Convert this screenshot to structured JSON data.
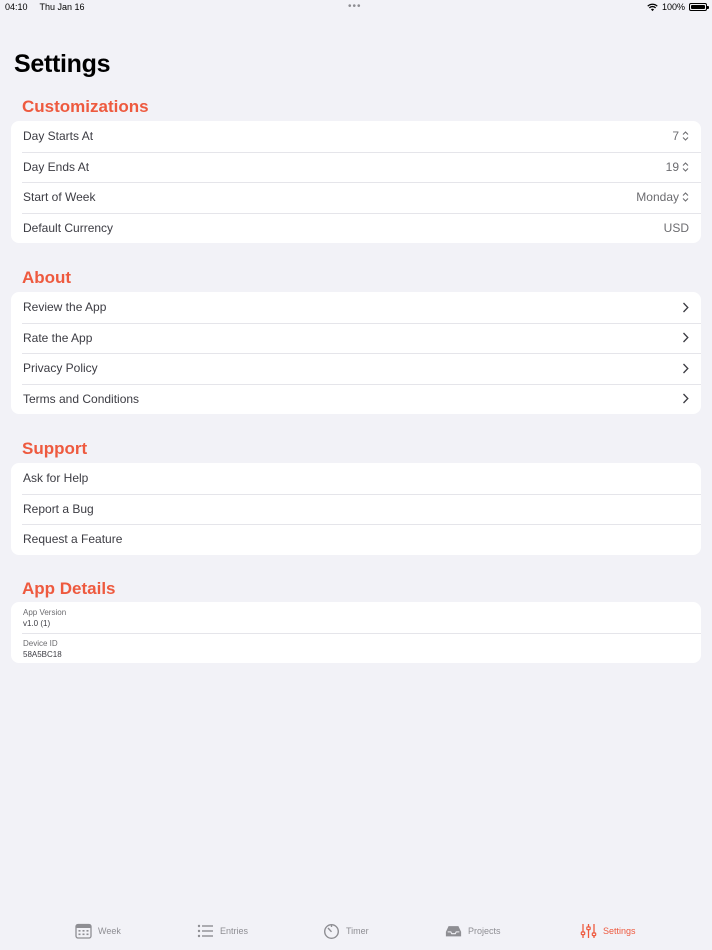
{
  "status_bar": {
    "time": "04:10",
    "date": "Thu Jan 16",
    "dots": "•••",
    "battery": "100%"
  },
  "page_title": "Settings",
  "accent_color": "#ee5a3f",
  "sections": {
    "customizations": {
      "title": "Customizations",
      "rows": [
        {
          "label": "Day Starts At",
          "value": "7"
        },
        {
          "label": "Day Ends At",
          "value": "19"
        },
        {
          "label": "Start of Week",
          "value": "Monday"
        },
        {
          "label": "Default Currency",
          "value": "USD"
        }
      ]
    },
    "about": {
      "title": "About",
      "rows": [
        {
          "label": "Review the App"
        },
        {
          "label": "Rate the App"
        },
        {
          "label": "Privacy Policy"
        },
        {
          "label": "Terms and Conditions"
        }
      ]
    },
    "support": {
      "title": "Support",
      "rows": [
        {
          "label": "Ask for Help"
        },
        {
          "label": "Report a Bug"
        },
        {
          "label": "Request a Feature"
        }
      ]
    },
    "app_details": {
      "title": "App Details",
      "rows": [
        {
          "title": "App Version",
          "value": "v1.0 (1)"
        },
        {
          "title": "Device ID",
          "value": "58A5BC18"
        }
      ]
    }
  },
  "tab_bar": {
    "tabs": [
      {
        "label": "Week",
        "icon": "calendar-icon"
      },
      {
        "label": "Entries",
        "icon": "list-icon"
      },
      {
        "label": "Timer",
        "icon": "timer-icon"
      },
      {
        "label": "Projects",
        "icon": "tray-icon"
      },
      {
        "label": "Settings",
        "icon": "sliders-icon",
        "active": true
      }
    ]
  }
}
